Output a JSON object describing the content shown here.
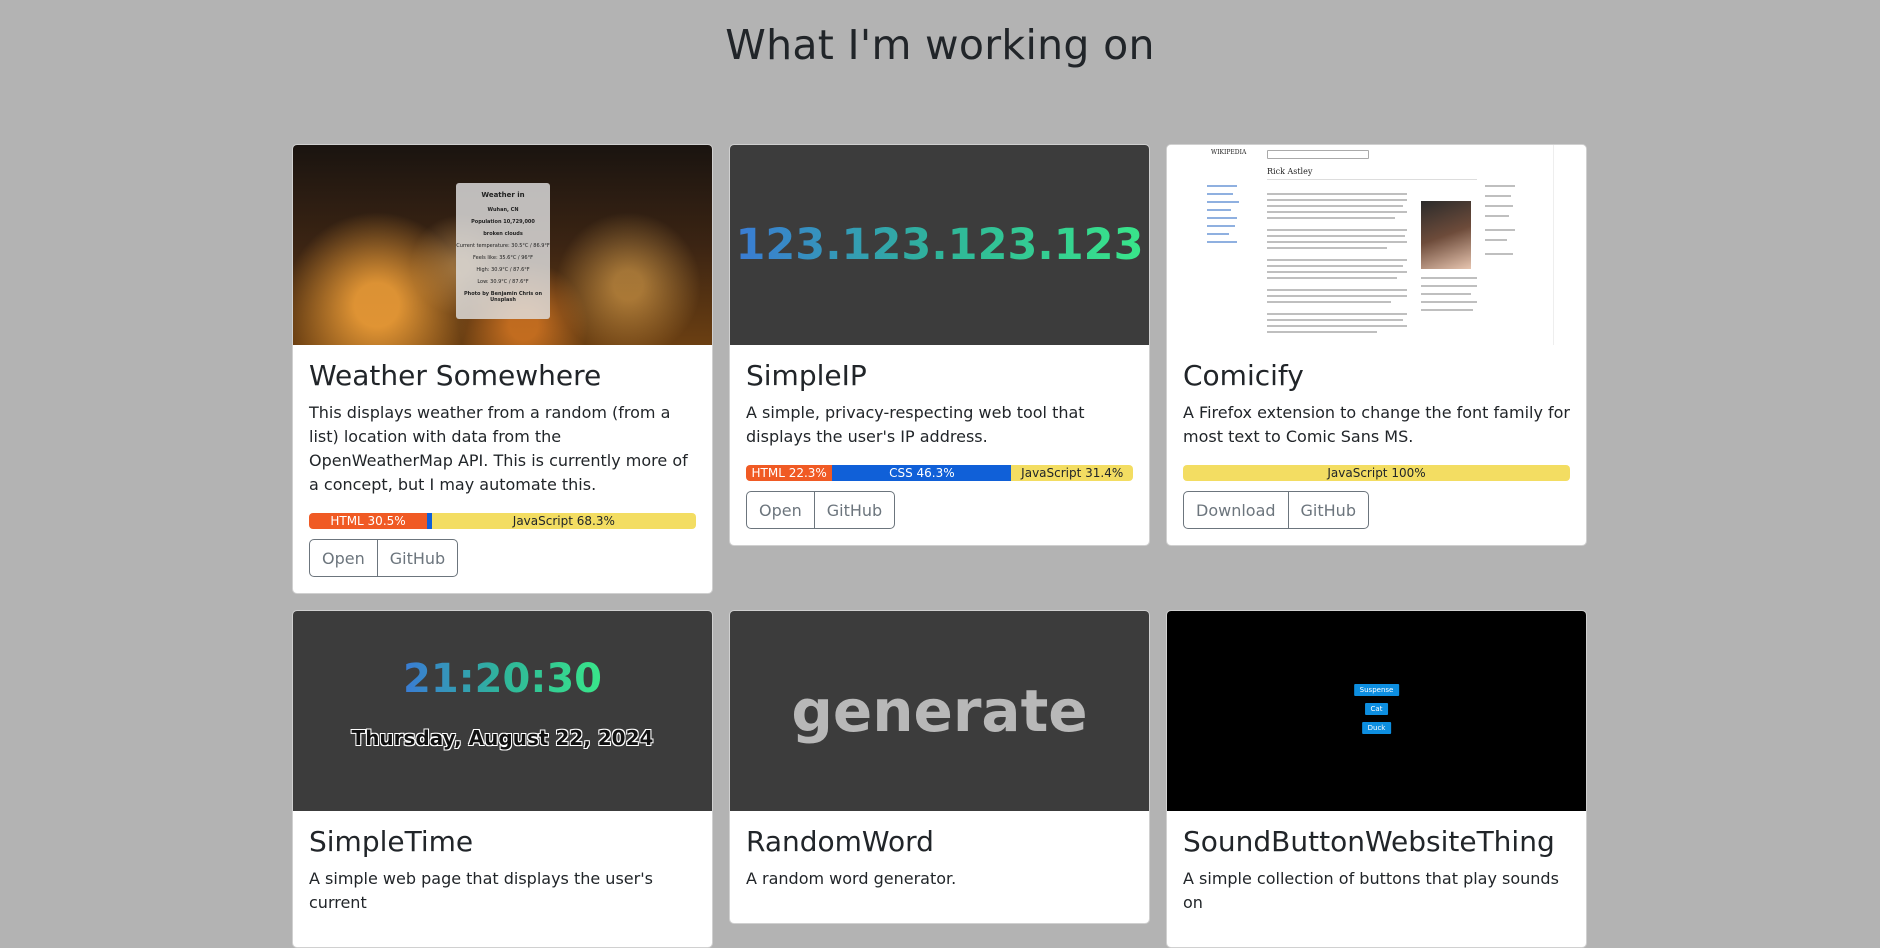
{
  "page": {
    "title": "What I'm working on"
  },
  "projects": [
    {
      "title": "Weather Somewhere",
      "description": "This displays weather from a random (from a list) location with data from the OpenWeatherMap API. This is currently more of a concept, but I may automate this.",
      "languages": [
        {
          "label": "HTML 30.5%",
          "percent": 30.5,
          "color": "#f05a24",
          "text_color": "#ffffff"
        },
        {
          "label": "",
          "percent": 1.2,
          "color": "#1060d8",
          "text_color": "#ffffff"
        },
        {
          "label": "JavaScript 68.3%",
          "percent": 68.3,
          "color": "#f3dd62",
          "text_color": "#212529"
        }
      ],
      "buttons": [
        "Open",
        "GitHub"
      ],
      "thumbnail": {
        "weather_title": "Weather in",
        "city": "Wuhan, CN",
        "population": "Population 10,729,000",
        "condition": "broken clouds",
        "current_temp": "Current temperature: 30.5°C / 86.9°F",
        "feels_like": "Feels like: 35.6°C / 96°F",
        "high": "High: 30.9°C / 87.6°F",
        "low": "Low: 30.9°C / 87.6°F",
        "credit": "Photo by Benjamin Chris on Unsplash"
      }
    },
    {
      "title": "SimpleIP",
      "description": "A simple, privacy-respecting web tool that displays the user's IP address.",
      "languages": [
        {
          "label": "HTML 22.3%",
          "percent": 22.3,
          "color": "#f05a24",
          "text_color": "#ffffff"
        },
        {
          "label": "CSS 46.3%",
          "percent": 46.3,
          "color": "#1060d8",
          "text_color": "#ffffff"
        },
        {
          "label": "JavaScript 31.4%",
          "percent": 31.4,
          "color": "#f3dd62",
          "text_color": "#212529"
        }
      ],
      "buttons": [
        "Open",
        "GitHub"
      ],
      "thumbnail": {
        "ip": "123.123.123.123"
      }
    },
    {
      "title": "Comicify",
      "description": "A Firefox extension to change the font family for most text to Comic Sans MS.",
      "languages": [
        {
          "label": "JavaScript 100%",
          "percent": 100,
          "color": "#f3dd62",
          "text_color": "#212529"
        }
      ],
      "buttons": [
        "Download",
        "GitHub"
      ],
      "thumbnail": {
        "logo": "WIKIPEDIA",
        "heading": "Rick Astley"
      }
    },
    {
      "title": "SimpleTime",
      "description": "A simple web page that displays the user's current",
      "languages": [],
      "buttons": [],
      "thumbnail": {
        "time": "21:20:30",
        "date": "Thursday, August 22, 2024"
      }
    },
    {
      "title": "RandomWord",
      "description": "A random word generator.",
      "languages": [],
      "buttons": [],
      "thumbnail": {
        "word": "generate"
      }
    },
    {
      "title": "SoundButtonWebsiteThing",
      "description": "A simple collection of buttons that play sounds on",
      "languages": [],
      "buttons": [],
      "thumbnail": {
        "buttons": [
          "Suspense",
          "Cat",
          "Duck"
        ]
      }
    }
  ]
}
